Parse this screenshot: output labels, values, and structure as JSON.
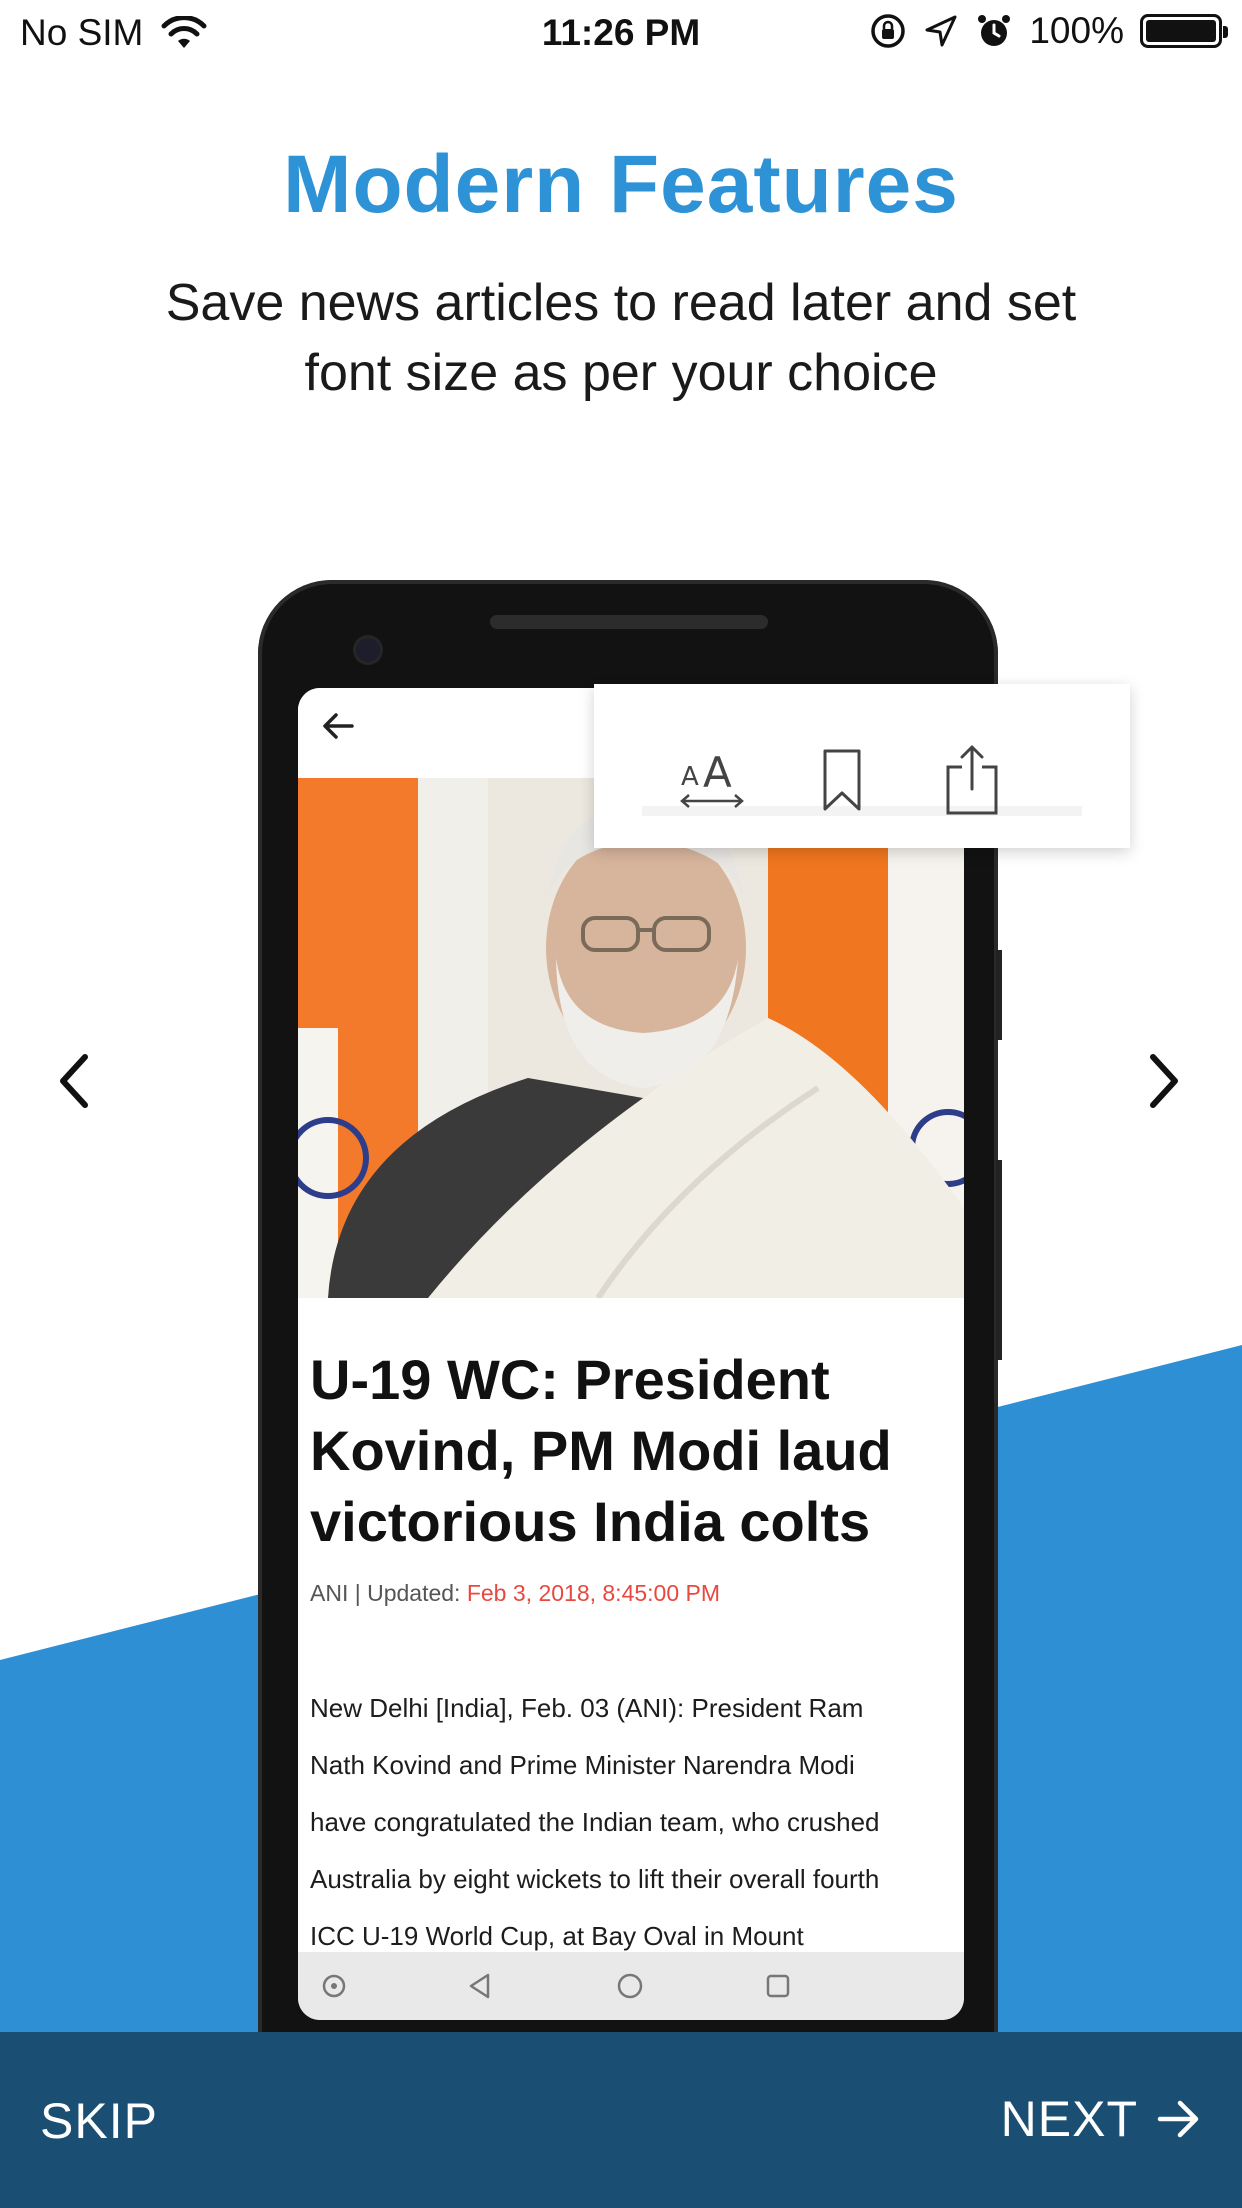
{
  "status_bar": {
    "carrier": "No SIM",
    "time": "11:26 PM",
    "battery": "100%"
  },
  "onboarding": {
    "title": "Modern Features",
    "subtitle_line1": "Save news articles to read later and set",
    "subtitle_line2": "font size as per your choice",
    "accent_color": "#2e93d6"
  },
  "article_preview": {
    "headline_lines": [
      "U-19 WC: President",
      "Kovind, PM Modi laud",
      "victorious India colts"
    ],
    "source": "ANI | Updated: ",
    "date": "Feb 3, 2018, 8:45:00 PM",
    "body_lines": [
      "New Delhi [India], Feb. 03 (ANI): President Ram",
      "Nath Kovind and Prime Minister Narendra Modi",
      "have congratulated the Indian team, who crushed",
      "Australia by eight wickets to lift their overall fourth",
      "ICC U-19 World Cup, at Bay Oval in Mount"
    ]
  },
  "toolbar": {
    "font_size_glyph": "AA",
    "icons": [
      "font-size-icon",
      "bookmark-icon",
      "share-icon"
    ]
  },
  "footer": {
    "skip_label": "SKIP",
    "next_label": "NEXT"
  }
}
